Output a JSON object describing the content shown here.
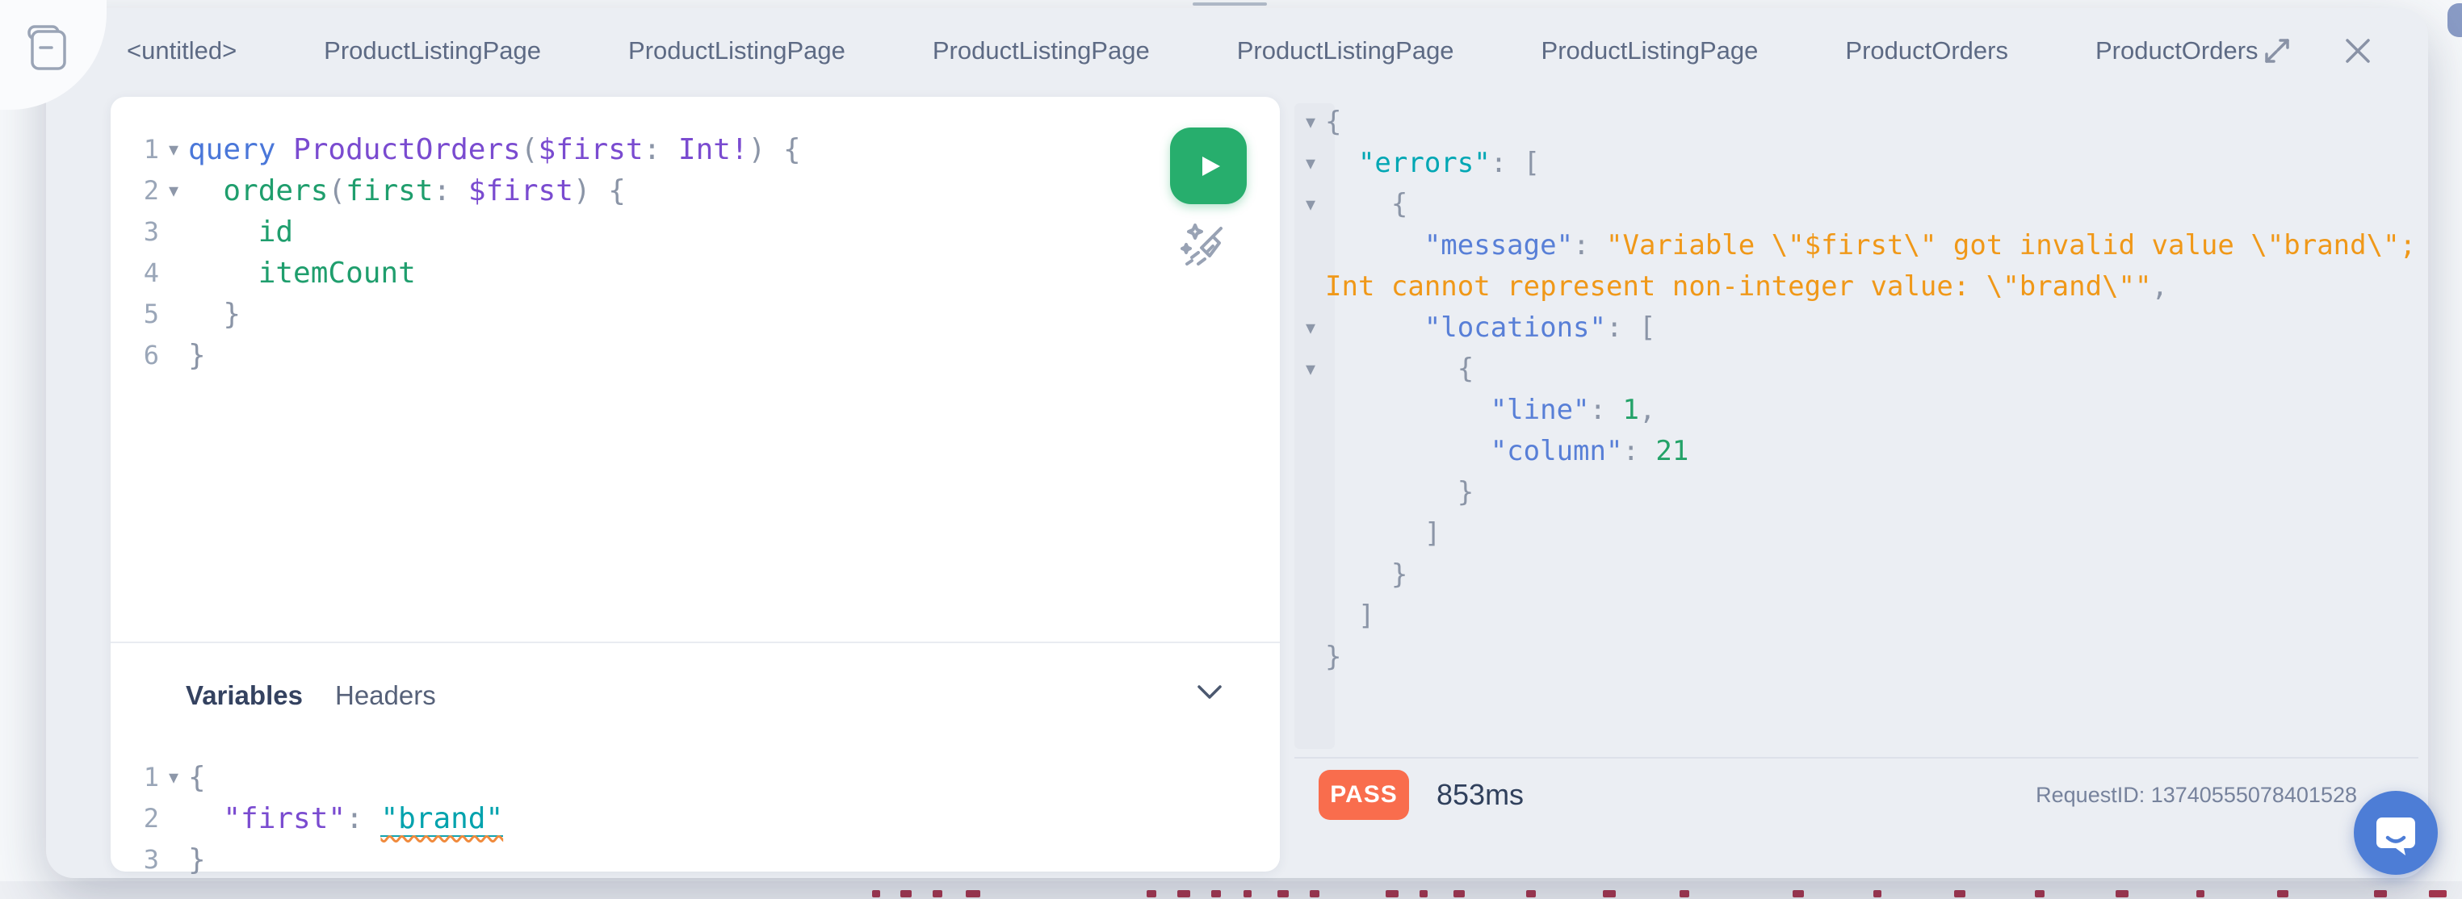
{
  "colors": {
    "run-green": "#27ae6d",
    "pass-orange": "#f96d4d",
    "chat-blue": "#4d7dd6",
    "error-squiggle": "#f08a3c"
  },
  "header": {
    "tabs": [
      "<untitled>",
      "ProductListingPage",
      "ProductListingPage",
      "ProductListingPage",
      "ProductListingPage",
      "ProductListingPage",
      "ProductOrders",
      "ProductOrders"
    ]
  },
  "editor": {
    "lines": [
      {
        "n": "1",
        "f": true,
        "t": [
          [
            "query",
            "kw"
          ],
          [
            " ",
            ""
          ],
          [
            "ProductOrders",
            "def"
          ],
          [
            "(",
            "pn"
          ],
          [
            "$first",
            "def"
          ],
          [
            ": ",
            "pn"
          ],
          [
            "Int!",
            "def"
          ],
          [
            ") {",
            "pn"
          ]
        ]
      },
      {
        "n": "2",
        "f": true,
        "t": [
          [
            "  ",
            ""
          ],
          [
            "orders",
            "prop"
          ],
          [
            "(",
            "pn"
          ],
          [
            "first",
            "prop"
          ],
          [
            ": ",
            "pn"
          ],
          [
            "$first",
            "def"
          ],
          [
            ") {",
            "pn"
          ]
        ]
      },
      {
        "n": "3",
        "t": [
          [
            "    ",
            ""
          ],
          [
            "id",
            "prop"
          ]
        ]
      },
      {
        "n": "4",
        "t": [
          [
            "    ",
            ""
          ],
          [
            "itemCount",
            "prop"
          ]
        ]
      },
      {
        "n": "5",
        "t": [
          [
            "  }",
            "pn"
          ]
        ]
      },
      {
        "n": "6",
        "t": [
          [
            "}",
            "pn"
          ]
        ]
      }
    ]
  },
  "variables_panel": {
    "tabs": [
      {
        "label": "Variables"
      },
      {
        "label": "Headers"
      }
    ]
  },
  "variables_editor": {
    "lines": [
      {
        "n": "1",
        "f": true,
        "t": [
          [
            "{",
            "pn"
          ]
        ]
      },
      {
        "n": "2",
        "t": [
          [
            "  ",
            ""
          ],
          [
            "\"first\"",
            "vkey"
          ],
          [
            ": ",
            "pn"
          ],
          [
            "\"brand\"",
            "verr"
          ]
        ]
      },
      {
        "n": "3",
        "t": [
          [
            "}",
            "pn"
          ]
        ]
      }
    ]
  },
  "response": {
    "lines": [
      {
        "f": true,
        "t": [
          [
            "{",
            "pn"
          ]
        ]
      },
      {
        "f": true,
        "t": [
          [
            "  ",
            ""
          ],
          [
            "\"errors\"",
            "tkey"
          ],
          [
            ": ",
            "pn"
          ],
          [
            "[",
            "pn"
          ]
        ]
      },
      {
        "f": true,
        "t": [
          [
            "    {",
            "pn"
          ]
        ]
      },
      {
        "t": [
          [
            "      ",
            ""
          ],
          [
            "\"message\"",
            "bkey"
          ],
          [
            ": ",
            "pn"
          ],
          [
            "\"Variable \\\"$first\\\" got invalid value \\\"brand\\\";",
            "str"
          ]
        ]
      },
      {
        "t": [
          [
            "Int cannot represent non-integer value: \\\"brand\\\"\"",
            "str"
          ],
          [
            ",",
            "pn"
          ]
        ]
      },
      {
        "f": true,
        "t": [
          [
            "      ",
            ""
          ],
          [
            "\"locations\"",
            "bkey"
          ],
          [
            ": ",
            "pn"
          ],
          [
            "[",
            "pn"
          ]
        ]
      },
      {
        "f": true,
        "t": [
          [
            "        {",
            "pn"
          ]
        ]
      },
      {
        "t": [
          [
            "          ",
            ""
          ],
          [
            "\"line\"",
            "bkey"
          ],
          [
            ": ",
            "pn"
          ],
          [
            "1",
            "num"
          ],
          [
            ",",
            "pn"
          ]
        ]
      },
      {
        "t": [
          [
            "          ",
            ""
          ],
          [
            "\"column\"",
            "bkey"
          ],
          [
            ": ",
            "pn"
          ],
          [
            "21",
            "num"
          ]
        ]
      },
      {
        "t": [
          [
            "        }",
            "pn"
          ]
        ]
      },
      {
        "t": [
          [
            "      ]",
            "pn"
          ]
        ]
      },
      {
        "t": [
          [
            "    }",
            "pn"
          ]
        ]
      },
      {
        "t": [
          [
            "  ]",
            "pn"
          ]
        ]
      },
      {
        "t": [
          [
            "}",
            "pn"
          ]
        ]
      }
    ]
  },
  "footer": {
    "status_label": "PASS",
    "duration": "853ms",
    "request_id": "RequestID: 13740555078401528"
  }
}
